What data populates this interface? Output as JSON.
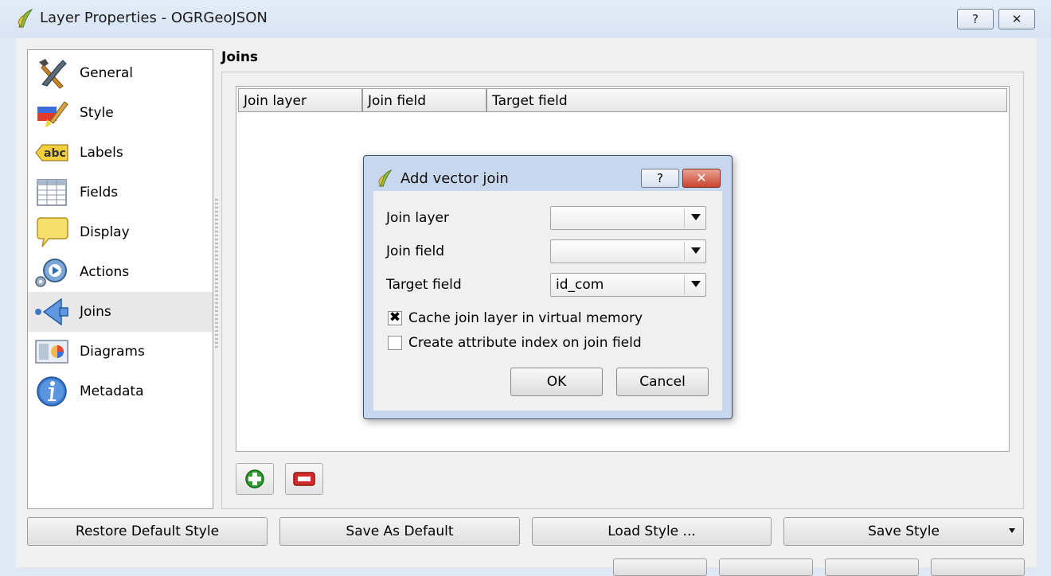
{
  "window": {
    "title": "Layer Properties - OGRGeoJSON",
    "help_label": "?",
    "close_label": "✕"
  },
  "sidebar": {
    "items": [
      {
        "label": "General"
      },
      {
        "label": "Style"
      },
      {
        "label": "Labels"
      },
      {
        "label": "Fields"
      },
      {
        "label": "Display"
      },
      {
        "label": "Actions"
      },
      {
        "label": "Joins"
      },
      {
        "label": "Diagrams"
      },
      {
        "label": "Metadata"
      }
    ],
    "labels_icon_text": "abc",
    "selected": "Joins"
  },
  "main": {
    "section_title": "Joins",
    "table": {
      "columns": [
        "Join layer",
        "Join field",
        "Target field"
      ],
      "rows": []
    }
  },
  "bottom_buttons": {
    "restore_default_style": "Restore Default Style",
    "save_as_default": "Save As Default",
    "load_style": "Load Style ...",
    "save_style": "Save Style"
  },
  "dialog": {
    "title": "Add vector join",
    "help_label": "?",
    "close_label": "✕",
    "join_layer_label": "Join layer",
    "join_layer_value": "",
    "join_field_label": "Join field",
    "join_field_value": "",
    "target_field_label": "Target field",
    "target_field_value": "id_com",
    "cache_label": "Cache join layer in virtual memory",
    "cache_checked": true,
    "index_label": "Create attribute index on join field",
    "index_checked": false,
    "ok_label": "OK",
    "cancel_label": "Cancel"
  },
  "icons": {
    "window": "qgis-icon",
    "general": "hammer-wrench-icon",
    "style": "paintbrush-icon",
    "labels": "abc-label-icon",
    "fields": "table-icon",
    "display": "speech-bubble-icon",
    "actions": "gear-play-icon",
    "joins": "join-arrow-icon",
    "diagrams": "diagram-icon",
    "metadata": "info-icon"
  },
  "colors": {
    "selected_bg": "#e8e8e8",
    "dialog_frame": "#c7d8ee",
    "add_green": "#2e9e2e",
    "remove_red": "#d42a2a"
  }
}
